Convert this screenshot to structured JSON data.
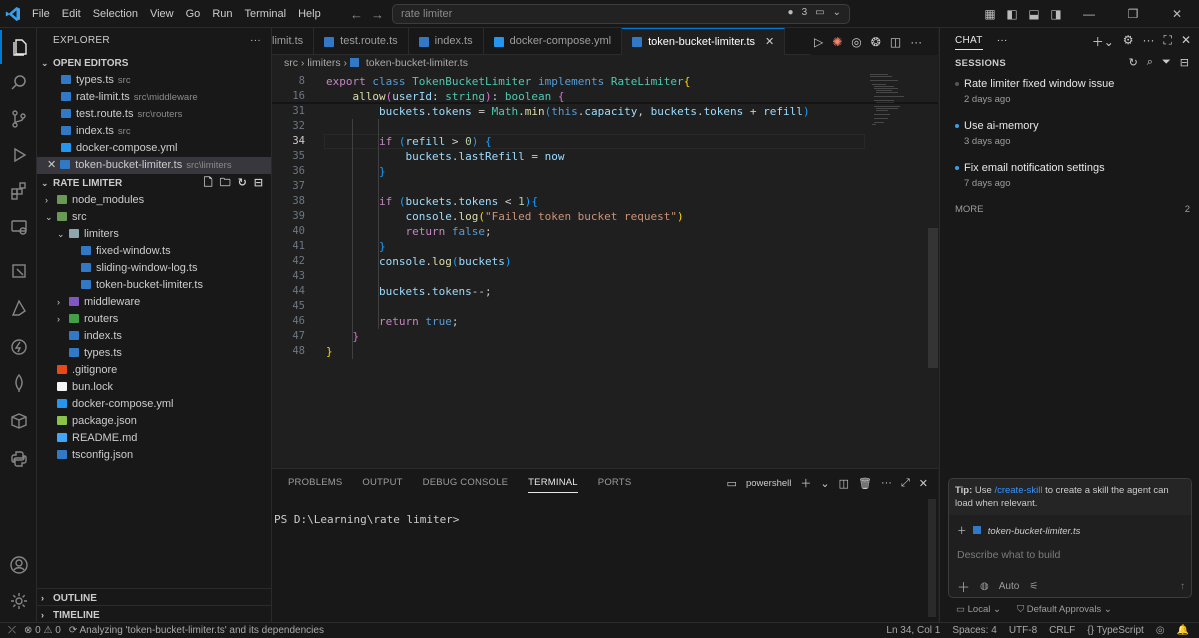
{
  "menu": [
    "File",
    "Edit",
    "Selection",
    "View",
    "Go",
    "Run",
    "Terminal",
    "Help"
  ],
  "command_center": {
    "text": "rate limiter",
    "agent_count": "3"
  },
  "explorer": {
    "title": "EXPLORER",
    "open_editors_label": "OPEN EDITORS",
    "open_editors": [
      {
        "name": "types.ts",
        "hint": "src",
        "color": "#3178c6"
      },
      {
        "name": "rate-limit.ts",
        "hint": "src\\middleware",
        "color": "#3178c6"
      },
      {
        "name": "test.route.ts",
        "hint": "src\\routers",
        "color": "#3178c6"
      },
      {
        "name": "index.ts",
        "hint": "src",
        "color": "#3178c6"
      },
      {
        "name": "docker-compose.yml",
        "hint": "",
        "color": "#2496ed"
      },
      {
        "name": "token-bucket-limiter.ts",
        "hint": "src\\limiters",
        "color": "#3178c6",
        "close": "✕"
      }
    ],
    "project_label": "RATE LIMITER",
    "tree": [
      {
        "name": "node_modules",
        "depth": 0,
        "chev": "›",
        "color": "#6a9955"
      },
      {
        "name": "src",
        "depth": 0,
        "chev": "⌄",
        "color": "#6a9955"
      },
      {
        "name": "limiters",
        "depth": 1,
        "chev": "⌄",
        "color": "#90a4ae"
      },
      {
        "name": "fixed-window.ts",
        "depth": 2,
        "chev": "",
        "color": "#3178c6"
      },
      {
        "name": "sliding-window-log.ts",
        "depth": 2,
        "chev": "",
        "color": "#3178c6"
      },
      {
        "name": "token-bucket-limiter.ts",
        "depth": 2,
        "chev": "",
        "color": "#3178c6"
      },
      {
        "name": "middleware",
        "depth": 1,
        "chev": "›",
        "color": "#7e57c2"
      },
      {
        "name": "routers",
        "depth": 1,
        "chev": "›",
        "color": "#43a047"
      },
      {
        "name": "index.ts",
        "depth": 1,
        "chev": "",
        "color": "#3178c6"
      },
      {
        "name": "types.ts",
        "depth": 1,
        "chev": "",
        "color": "#3178c6"
      },
      {
        "name": ".gitignore",
        "depth": 0,
        "chev": "",
        "color": "#e64a19"
      },
      {
        "name": "bun.lock",
        "depth": 0,
        "chev": "",
        "color": "#f5f5f5"
      },
      {
        "name": "docker-compose.yml",
        "depth": 0,
        "chev": "",
        "color": "#2496ed"
      },
      {
        "name": "package.json",
        "depth": 0,
        "chev": "",
        "color": "#8bc34a"
      },
      {
        "name": "README.md",
        "depth": 0,
        "chev": "",
        "color": "#42a5f5"
      },
      {
        "name": "tsconfig.json",
        "depth": 0,
        "chev": "",
        "color": "#3178c6"
      }
    ],
    "outline_label": "OUTLINE",
    "timeline_label": "TIMELINE"
  },
  "tabs": [
    {
      "label": "limit.ts",
      "active": false,
      "color": "#3178c6"
    },
    {
      "label": "test.route.ts",
      "active": false,
      "color": "#3178c6"
    },
    {
      "label": "index.ts",
      "active": false,
      "color": "#3178c6"
    },
    {
      "label": "docker-compose.yml",
      "active": false,
      "color": "#2496ed"
    },
    {
      "label": "token-bucket-limiter.ts",
      "active": true,
      "color": "#3178c6"
    }
  ],
  "breadcrumb": [
    "src",
    "limiters",
    "token-bucket-limiter.ts"
  ],
  "code_lines": [
    {
      "n": "8",
      "html": "<span class=\"ct\">export</span> <span class=\"kw\">class</span> <span class=\"cls\">TokenBucketLimiter</span> <span class=\"kw\">implements</span> <span class=\"cls\">RateLimiter</span><span class=\"br1\">{</span>"
    },
    {
      "n": "16",
      "html": "    <span class=\"fn\">allow</span><span class=\"br2\">(</span><span class=\"vr\">userId</span>: <span class=\"cls\">string</span><span class=\"br2\">)</span>: <span class=\"cls\">boolean</span> <span class=\"br2\">{</span>"
    },
    {
      "n": "31",
      "html": "        <span class=\"vr\">buckets</span>.<span class=\"vr\">tokens</span> = <span class=\"cls\">Math</span>.<span class=\"fn\">min</span><span class=\"br3\">(</span><span class=\"kw\">this</span>.<span class=\"vr\">capacity</span>, <span class=\"vr\">buckets</span>.<span class=\"vr\">tokens</span> + <span class=\"vr\">refill</span><span class=\"br3\">)</span>"
    },
    {
      "n": "32",
      "html": ""
    },
    {
      "n": "34",
      "html": "        <span class=\"ct\">if</span> <span class=\"br3\">(</span><span class=\"vr\">refill</span> &gt; <span class=\"nu\">0</span><span class=\"br3\">)</span> <span class=\"br3\">{</span>",
      "cur": true
    },
    {
      "n": "35",
      "html": "            <span class=\"vr\">buckets</span>.<span class=\"vr\">lastRefill</span> = <span class=\"vr\">now</span>"
    },
    {
      "n": "36",
      "html": "        <span class=\"br3\">}</span>"
    },
    {
      "n": "37",
      "html": ""
    },
    {
      "n": "38",
      "html": "        <span class=\"ct\">if</span> <span class=\"br3\">(</span><span class=\"vr\">buckets</span>.<span class=\"vr\">tokens</span> &lt; <span class=\"nu\">1</span><span class=\"br3\">)</span><span class=\"br3\">{</span>"
    },
    {
      "n": "39",
      "html": "            <span class=\"vr\">console</span>.<span class=\"fn\">log</span><span class=\"br1\">(</span><span class=\"st\">\"Failed token bucket request\"</span><span class=\"br1\">)</span>"
    },
    {
      "n": "40",
      "html": "            <span class=\"ct\">return</span> <span class=\"kw\">false</span>;"
    },
    {
      "n": "41",
      "html": "        <span class=\"br3\">}</span>"
    },
    {
      "n": "42",
      "html": "        <span class=\"vr\">console</span>.<span class=\"fn\">log</span><span class=\"br3\">(</span><span class=\"vr\">buckets</span><span class=\"br3\">)</span>"
    },
    {
      "n": "43",
      "html": ""
    },
    {
      "n": "44",
      "html": "        <span class=\"vr\">buckets</span>.<span class=\"vr\">tokens</span>--;"
    },
    {
      "n": "45",
      "html": ""
    },
    {
      "n": "46",
      "html": "        <span class=\"ct\">return</span> <span class=\"kw\">true</span>;"
    },
    {
      "n": "47",
      "html": "    <span class=\"br2\">}</span>"
    },
    {
      "n": "48",
      "html": "<span class=\"br1\">}</span>"
    }
  ],
  "panel": {
    "tabs": [
      {
        "label": "PROBLEMS"
      },
      {
        "label": "OUTPUT"
      },
      {
        "label": "DEBUG CONSOLE"
      },
      {
        "label": "TERMINAL",
        "active": true
      },
      {
        "label": "PORTS"
      }
    ],
    "shell": "powershell",
    "prompt": "PS D:\\Learning\\rate limiter>"
  },
  "chat": {
    "tab": "CHAT",
    "sessions_label": "SESSIONS",
    "sessions": [
      {
        "title": "Rate limiter fixed window issue",
        "date": "2 days ago",
        "dot": false
      },
      {
        "title": "Use ai-memory",
        "date": "3 days ago",
        "dot": true
      },
      {
        "title": "Fix email notification settings",
        "date": "7 days ago",
        "dot": true
      }
    ],
    "more_label": "MORE",
    "more_count": "2",
    "tip_prefix": "Tip:",
    "tip_pre": "Use",
    "tip_link": "/create-skill",
    "tip_post": "to create a skill the agent can load when relevant.",
    "attachment": "token-bucket-limiter.ts",
    "placeholder": "Describe what to build",
    "mode": "Auto",
    "footer_local": "Local",
    "footer_approvals": "Default Approvals"
  },
  "status": {
    "errors": "0",
    "warnings": "0",
    "message": "Analyzing 'token-bucket-limiter.ts' and its dependencies",
    "position": "Ln 34, Col 1",
    "spaces": "Spaces: 4",
    "encoding": "UTF-8",
    "eol": "CRLF",
    "language": "TypeScript"
  }
}
